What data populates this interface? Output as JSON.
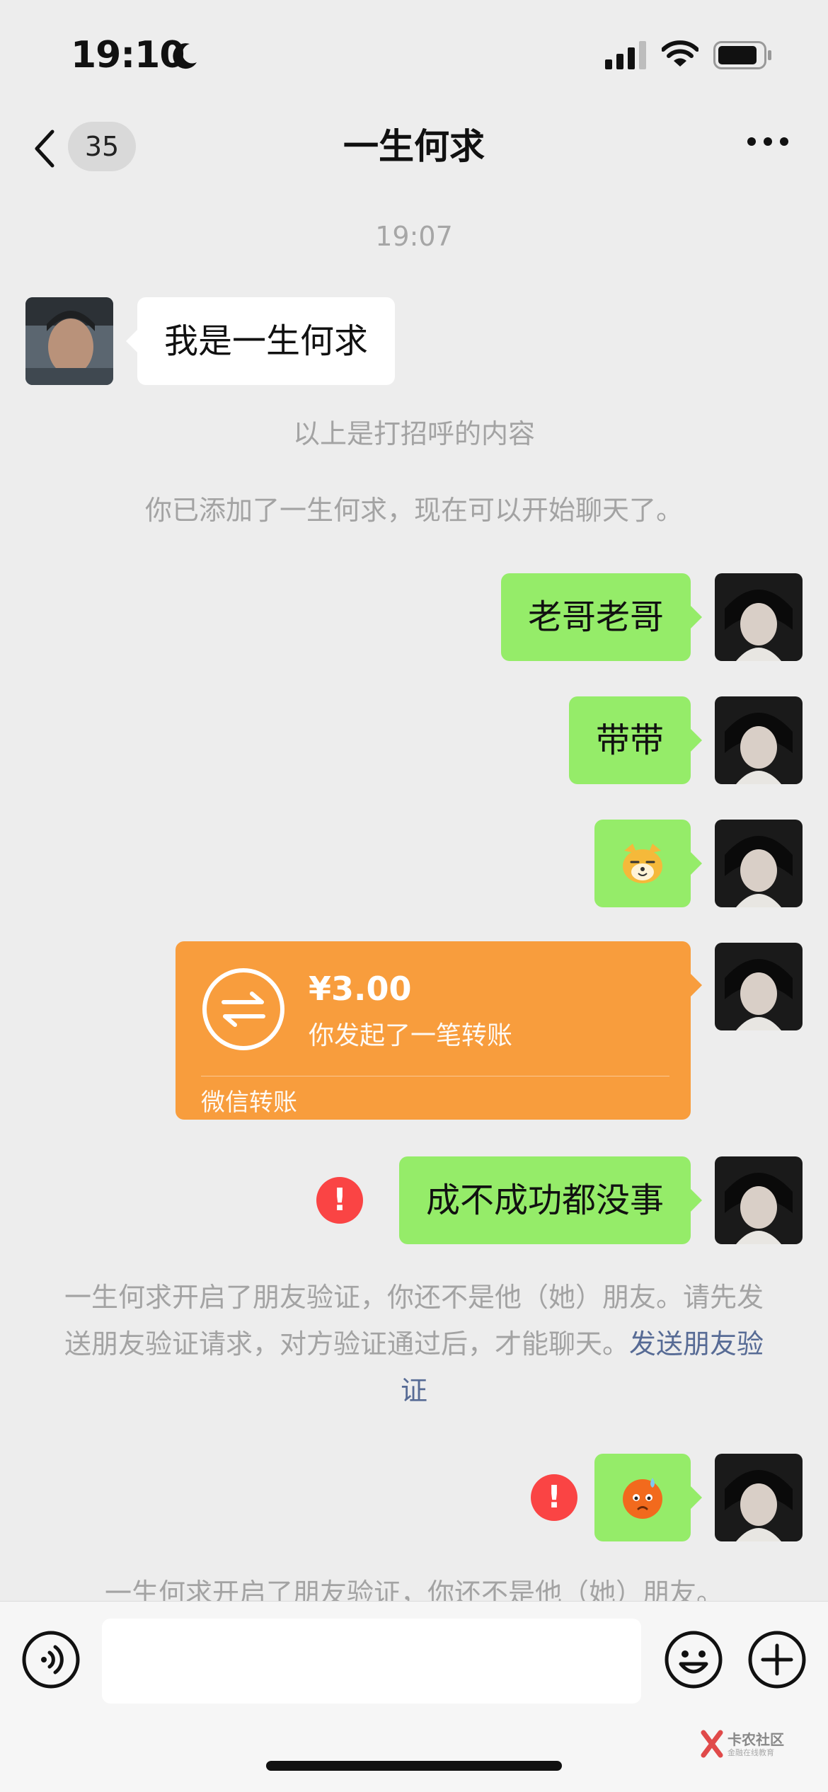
{
  "status_bar": {
    "time": "19:10",
    "icons": [
      "moon-icon",
      "signal-icon",
      "wifi-icon",
      "battery-icon"
    ]
  },
  "nav": {
    "back_icon": "chevron-left-icon",
    "unread_count": "35",
    "title": "一生何求",
    "more_icon": "more-dots-icon"
  },
  "chat": {
    "timestamp": "19:07",
    "greeting_message": "我是一生何求",
    "greeting_note": "以上是打招呼的内容",
    "added_note": "你已添加了一生何求，现在可以开始聊天了。",
    "messages_out": [
      "老哥老哥",
      "带带"
    ],
    "sticker_1": "cat-face-sticker",
    "transfer": {
      "amount": "¥3.00",
      "description": "你发起了一笔转账",
      "footer": "微信转账"
    },
    "failed_message": "成不成功都没事",
    "verify_note_1": "一生何求开启了朋友验证，你还不是他（她）朋友。请先发送朋友验证请求，对方验证通过后，才能聊天。",
    "verify_link": "发送朋友验证",
    "sticker_2": "sweat-face-sticker",
    "verify_note_2_partial": "一生何求开启了朋友验证，你还不是他（她）朋友。"
  },
  "input_bar": {
    "voice_icon": "voice-icon",
    "emoji_icon": "emoji-icon",
    "plus_icon": "plus-icon",
    "text_value": ""
  },
  "watermark": {
    "title": "卡农社区",
    "subtitle": "金融在线教育"
  },
  "colors": {
    "background": "#ededed",
    "outgoing_bubble": "#95ec69",
    "incoming_bubble": "#ffffff",
    "transfer_card": "#f89d3d",
    "link": "#576b95",
    "error": "#fa4444"
  }
}
